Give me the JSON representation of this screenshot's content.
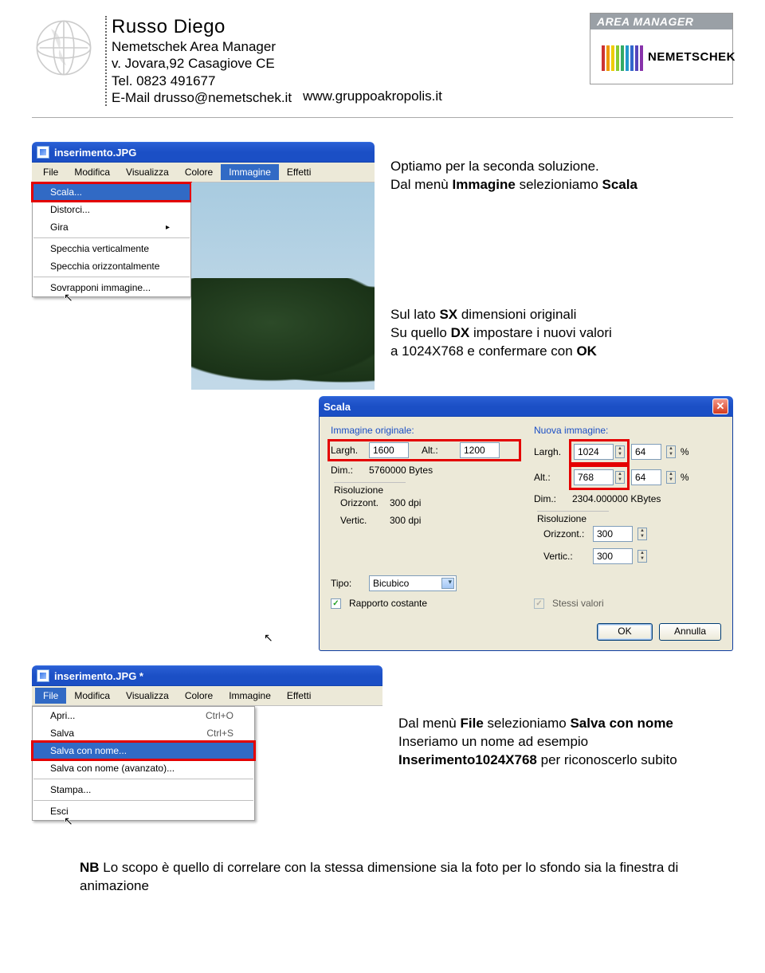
{
  "header": {
    "name": "Russo Diego",
    "role": "Nemetschek Area Manager",
    "address": "v. Jovara,92 Casagiove CE",
    "tel": "Tel. 0823 491677",
    "email": "E-Mail drusso@nemetschek.it",
    "website": "www.gruppoakropolis.it",
    "logo_tag": "AREA MANAGER",
    "logo_brand": "NEMETSCHEK"
  },
  "win1": {
    "title": "inserimento.JPG",
    "menubar": [
      "File",
      "Modifica",
      "Visualizza",
      "Colore",
      "Immagine",
      "Effetti"
    ],
    "active_menu": "Immagine",
    "menu_items": [
      {
        "label": "Scala...",
        "hi": true,
        "boxed": true
      },
      {
        "label": "Distorci...",
        "cursor": true
      },
      {
        "label": "Gira",
        "arrow": true
      },
      {
        "sep": true
      },
      {
        "label": "Specchia verticalmente"
      },
      {
        "label": "Specchia orizzontalmente"
      },
      {
        "sep": true
      },
      {
        "label": "Sovrapponi immagine..."
      }
    ]
  },
  "text1a": "Optiamo per la seconda soluzione.",
  "text1b_pre": "Dal menù ",
  "text1b_b1": "Immagine",
  "text1b_mid": " selezioniamo ",
  "text1b_b2": "Scala",
  "text2_l1_pre": "Sul lato ",
  "text2_l1_b": "SX",
  "text2_l1_post": " dimensioni originali",
  "text2_l2_pre": "Su quello ",
  "text2_l2_b": "DX",
  "text2_l2_post": " impostare i nuovi valori",
  "text2_l3_pre": "a 1024X768 e confermare con ",
  "text2_l3_b": "OK",
  "dialog": {
    "title": "Scala",
    "left": {
      "group": "Immagine originale:",
      "largh_label": "Largh.",
      "largh": "1600",
      "alt_label": "Alt.:",
      "alt": "1200",
      "dim_label": "Dim.:",
      "dim": "5760000 Bytes",
      "res_label": "Risoluzione",
      "oriz_label": "Orizzont.",
      "oriz": "300 dpi",
      "vert_label": "Vertic.",
      "vert": "300 dpi"
    },
    "right": {
      "group": "Nuova immagine:",
      "largh_label": "Largh.",
      "largh": "1024",
      "largh_pct": "64",
      "pct": "%",
      "alt_label": "Alt.:",
      "alt": "768",
      "alt_pct": "64",
      "dim_label": "Dim.:",
      "dim": "2304.000000 KBytes",
      "res_label": "Risoluzione",
      "oriz_label": "Orizzont.:",
      "oriz": "300",
      "vert_label": "Vertic.:",
      "vert": "300"
    },
    "tipo_label": "Tipo:",
    "tipo": "Bicubico",
    "rapporto": "Rapporto costante",
    "stessi": "Stessi valori",
    "ok": "OK",
    "cancel": "Annulla"
  },
  "win3": {
    "title": "inserimento.JPG *",
    "menubar": [
      "File",
      "Modifica",
      "Visualizza",
      "Colore",
      "Immagine",
      "Effetti"
    ],
    "active_menu": "File",
    "menu_items": [
      {
        "label": "Apri...",
        "shortcut": "Ctrl+O"
      },
      {
        "label": "Salva",
        "shortcut": "Ctrl+S"
      },
      {
        "label": "Salva con nome...",
        "hi": true,
        "boxed": true,
        "cursor": true
      },
      {
        "label": "Salva con nome (avanzato)..."
      },
      {
        "sep": true
      },
      {
        "label": "Stampa..."
      },
      {
        "sep": true
      },
      {
        "label": "Esci"
      }
    ]
  },
  "text3_l1_pre": "Dal menù ",
  "text3_l1_b1": "File",
  "text3_l1_mid": " selezioniamo ",
  "text3_l1_b2": "Salva con nome",
  "text3_l2": "Inseriamo un nome ad esempio",
  "text3_l3_b": "Inserimento1024X768",
  "text3_l3_post": " per riconoscerlo subito",
  "foot_b": "NB",
  "foot_txt": " Lo scopo è quello di correlare con la stessa dimensione sia la foto per lo sfondo sia la finestra di animazione"
}
